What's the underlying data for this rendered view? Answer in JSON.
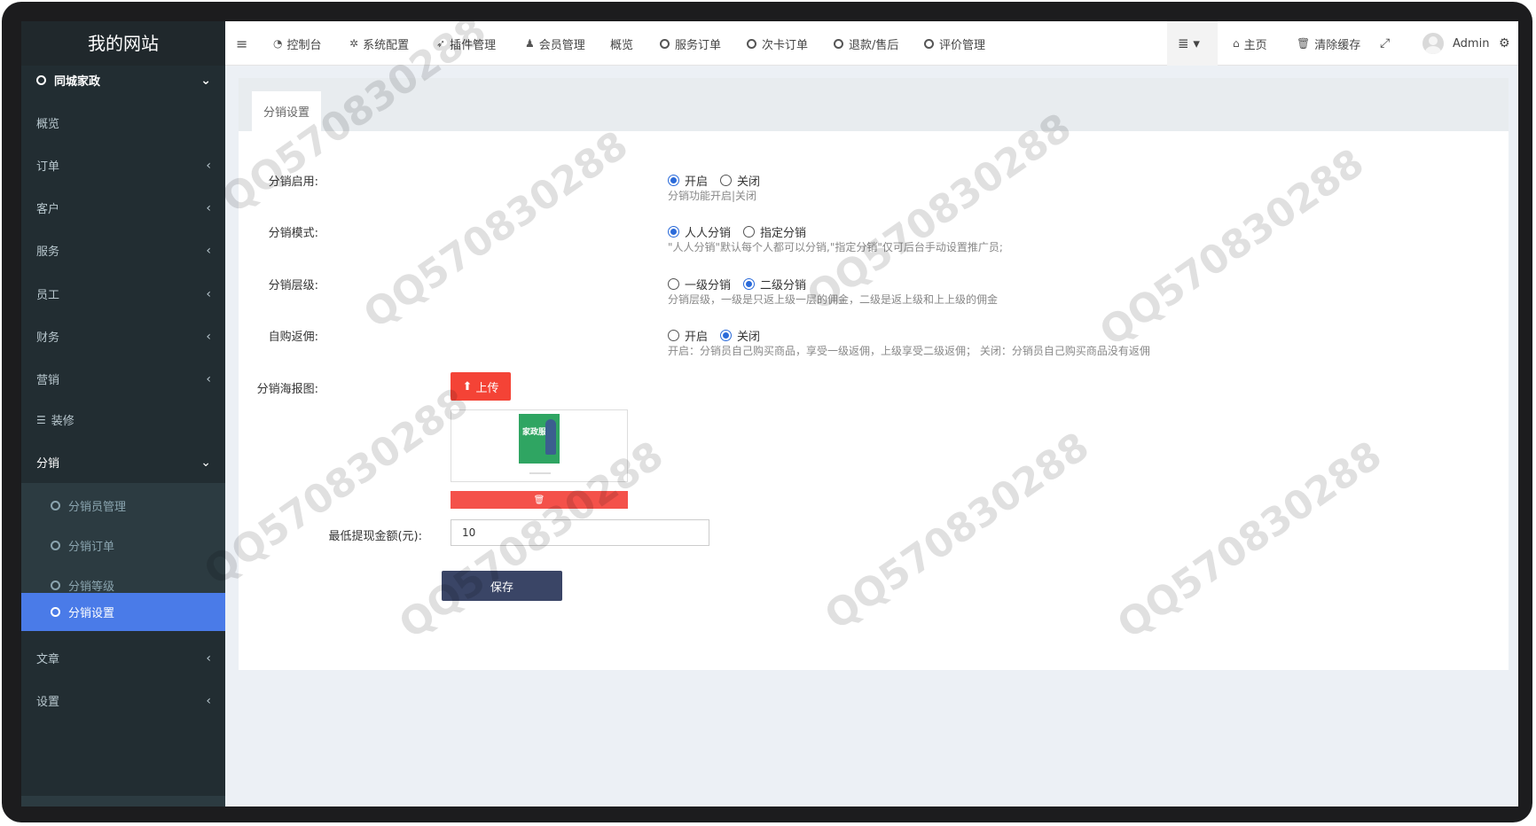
{
  "sidebar": {
    "logo": "我的网站",
    "top_item": "同城家政",
    "items": [
      "概览",
      "订单",
      "客户",
      "服务",
      "员工",
      "财务",
      "营销",
      "装修",
      "分销"
    ],
    "sub_items": [
      "分销员管理",
      "分销订单",
      "分销等级",
      "分销设置"
    ],
    "bottom_items": [
      "文章",
      "设置"
    ]
  },
  "topbar": {
    "items": [
      "控制台",
      "系统配置",
      "插件管理",
      "会员管理",
      "概览",
      "服务订单",
      "次卡订单",
      "退款/售后",
      "评价管理"
    ],
    "home": "主页",
    "clear_cache": "清除缓存",
    "user": "Admin"
  },
  "tab": "分销设置",
  "form": {
    "enable_label": "分销启用:",
    "enable_opts": [
      "开启",
      "关闭"
    ],
    "enable_help": "分销功能开启|关闭",
    "mode_label": "分销模式:",
    "mode_opts": [
      "人人分销",
      "指定分销"
    ],
    "mode_help": "\"人人分销\"默认每个人都可以分销,\"指定分销\"仅可后台手动设置推广员;",
    "level_label": "分销层级:",
    "level_opts": [
      "一级分销",
      "二级分销"
    ],
    "level_help": "分销层级，一级是只返上级一层的佣金，二级是返上级和上上级的佣金",
    "self_label": "自购返佣:",
    "self_opts": [
      "开启",
      "关闭"
    ],
    "self_help": "开启：分销员自己购买商品，享受一级返佣，上级享受二级返佣； 关闭：分销员自己购买商品没有返佣",
    "poster_label": "分销海报图:",
    "upload": "上传",
    "poster_text": "家政服务",
    "min_label": "最低提现金额(元):",
    "min_value": "10",
    "save": "保存"
  },
  "watermark": "QQ570830288"
}
